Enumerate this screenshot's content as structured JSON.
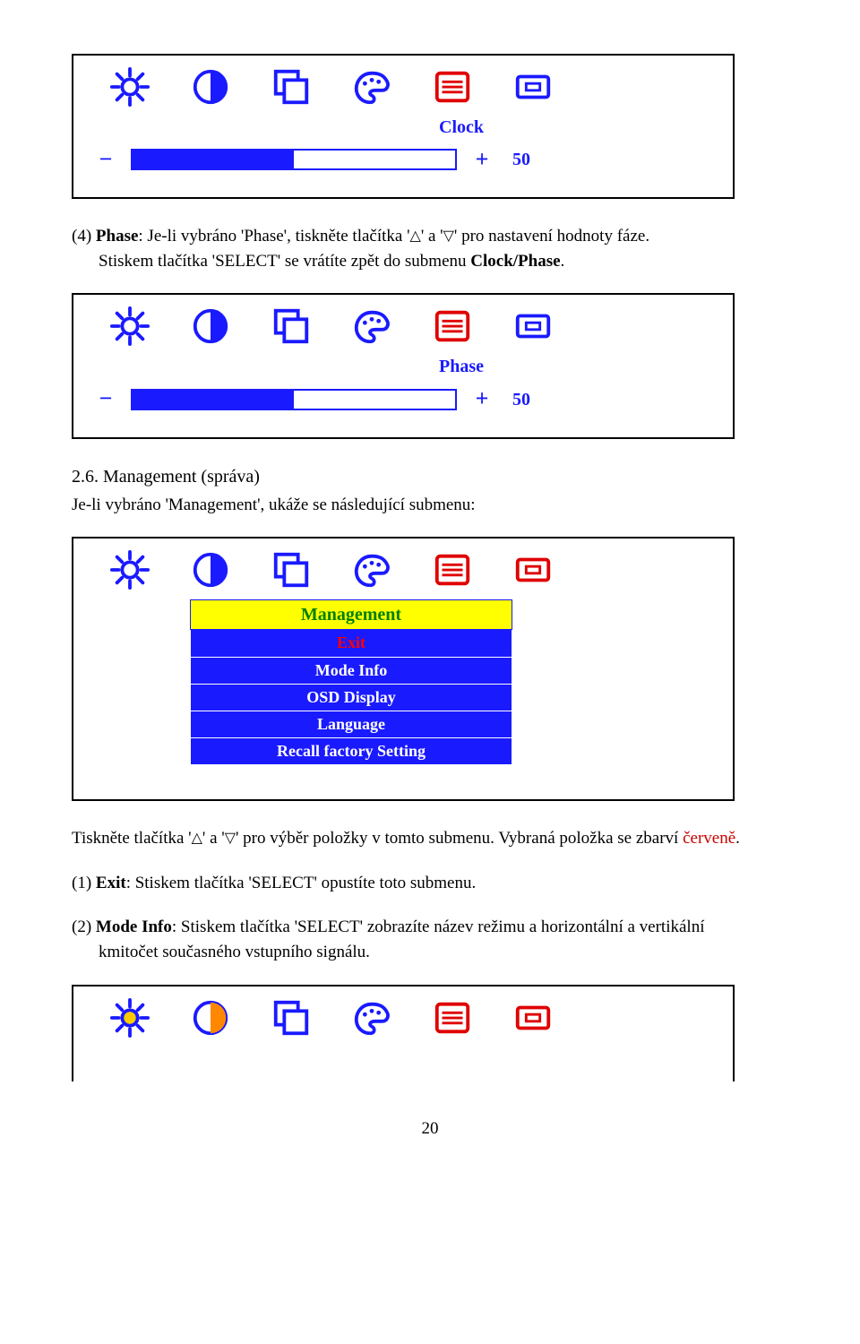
{
  "osd1": {
    "label": "Clock",
    "value": "50"
  },
  "para_phase": {
    "prefix": "(4) ",
    "bold": "Phase",
    "rest1": ": Je-li vybráno 'Phase', tiskněte tlačítka '",
    "tri1": "△",
    "rest2": "' a '",
    "tri2": "▽",
    "rest3": "' pro nastavení hodnoty fáze.",
    "indent": "Stiskem tlačítka 'SELECT' se vrátíte zpět do submenu ",
    "indent_bold": "Clock/Phase",
    "indent_end": "."
  },
  "osd2": {
    "label": "Phase",
    "value": "50"
  },
  "heading26": "2.6. Management (správa)",
  "heading26_sub": "Je-li vybráno 'Management', ukáže se následující submenu:",
  "menu": {
    "title": "Management",
    "items": [
      "Exit",
      "Mode Info",
      "OSD Display",
      "Language",
      "Recall factory Setting"
    ]
  },
  "para_tri": {
    "p1": "Tiskněte tlačítka '",
    "tri1": "△",
    "p2": "' a '",
    "tri2": "▽",
    "p3": "' pro výběr položky v tomto submenu. Vybraná položka se zbarví ",
    "red": "červeně",
    "p4": "."
  },
  "para_exit": {
    "prefix": "(1) ",
    "bold": "Exit",
    "rest": ": Stiskem tlačítka 'SELECT' opustíte toto submenu."
  },
  "para_mode": {
    "prefix": "(2) ",
    "bold": "Mode Info",
    "rest": ": Stiskem tlačítka 'SELECT' zobrazíte název režimu a horizontální a vertikální",
    "indent": "kmitočet současného vstupního signálu."
  },
  "pagenum": "20"
}
